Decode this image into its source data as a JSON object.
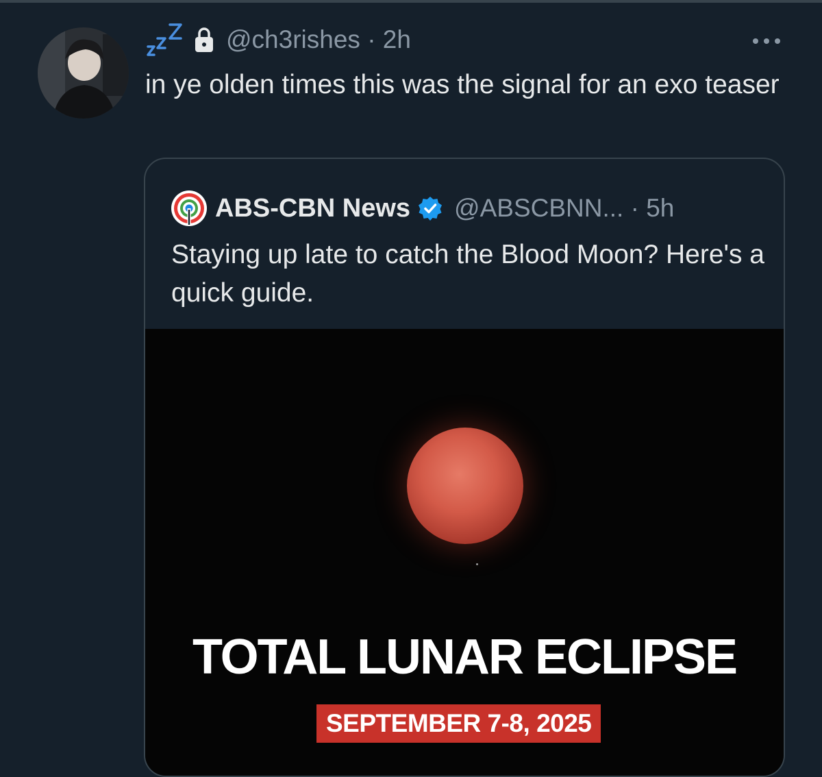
{
  "tweet": {
    "name_icon": "zzz-icon",
    "lock_icon": "lock-icon",
    "handle": "@ch3rishes",
    "separator": "·",
    "time": "2h",
    "handle_line": "@ch3rishes · 2h",
    "text": "in ye olden times this was the signal for an exo teaser",
    "more_icon": "more-icon"
  },
  "quote": {
    "logo_icon": "abs-cbn-logo",
    "name": "ABS-CBN News",
    "verified_icon": "verified-badge-icon",
    "handle_line": "@ABSCBNN... · 5h",
    "text": "Staying up late to catch the Blood Moon? Here's a quick guide.",
    "media": {
      "title": "TOTAL LUNAR ECLIPSE",
      "date": "SEPTEMBER 7-8, 2025"
    }
  },
  "colors": {
    "background": "#15202b",
    "text_primary": "#e7e9ea",
    "text_secondary": "#8b98a5",
    "border": "#38444d",
    "verified_blue": "#1d9bf0",
    "badge_red": "#c8322a"
  }
}
